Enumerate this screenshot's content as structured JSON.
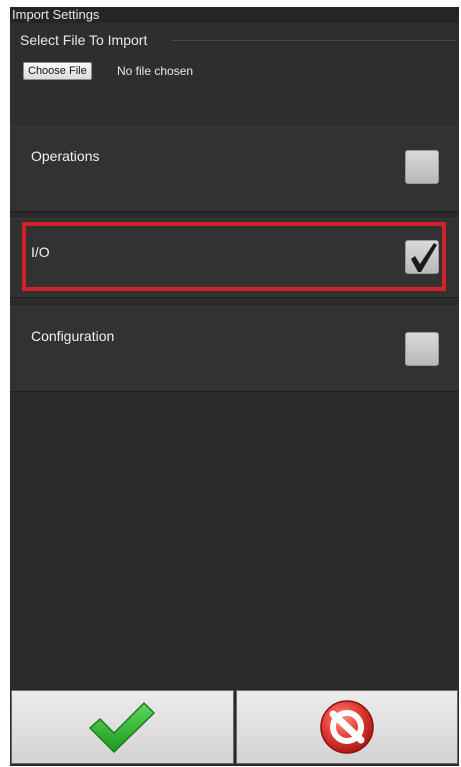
{
  "dialog": {
    "title": "Import Settings"
  },
  "file_section": {
    "legend": "Select File To Import",
    "choose_button_label": "Choose File",
    "status": "No file chosen"
  },
  "options": [
    {
      "label": "Operations",
      "checked": false
    },
    {
      "label": "I/O",
      "checked": true
    },
    {
      "label": "Configuration",
      "checked": false
    }
  ],
  "footer": {
    "confirm_icon": "checkmark-icon",
    "cancel_icon": "cancel-icon"
  },
  "colors": {
    "highlight": "#d1222c",
    "confirm": "#2fb52f",
    "cancel": "#d62b2b"
  }
}
